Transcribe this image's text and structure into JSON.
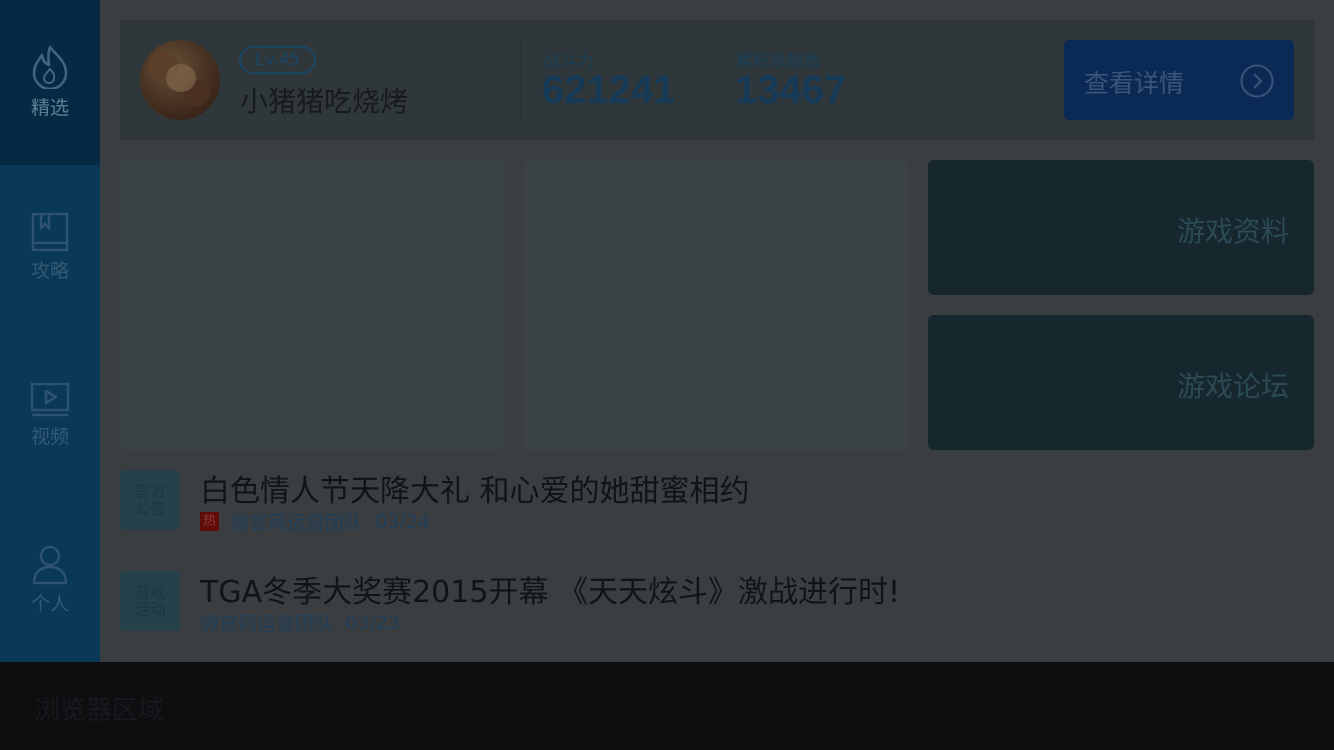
{
  "sidebar": {
    "items": [
      {
        "label": "精选",
        "icon": "flame-icon",
        "active": true
      },
      {
        "label": "攻略",
        "icon": "book-icon",
        "active": false
      },
      {
        "label": "视频",
        "icon": "video-play-icon",
        "active": false
      },
      {
        "label": "个人",
        "icon": "person-icon",
        "active": false
      }
    ]
  },
  "profile": {
    "level": "Lv.45",
    "nickname": "小猪猪吃烧烤",
    "stats": [
      {
        "label": "战斗力",
        "value": "621241"
      },
      {
        "label": "累积杀敌数",
        "value": "13467"
      }
    ],
    "detail_button": "查看详情"
  },
  "tiles": {
    "right": [
      {
        "title": "游戏资料"
      },
      {
        "title": "游戏论坛"
      }
    ]
  },
  "news": [
    {
      "badge_line1": "官方",
      "badge_line2": "公告",
      "title": "白色情人节天降大礼 和心爱的她甜蜜相约",
      "hot": "热",
      "author": "微官网运营团队",
      "date": "03/24"
    },
    {
      "badge_line1": "游戏",
      "badge_line2": "活动",
      "title": "TGA冬季大奖赛2015开幕 《天天炫斗》激战进行时!",
      "author": "微官网运营团队",
      "date": "03/23"
    }
  ],
  "browser_area": {
    "label": "浏览器区域"
  },
  "colors": {
    "sidebar_bg": "#0a3857",
    "sidebar_active_bg": "#062a44",
    "accent_button": "#0a2a55",
    "overlay_dim": "#3a3e41"
  }
}
